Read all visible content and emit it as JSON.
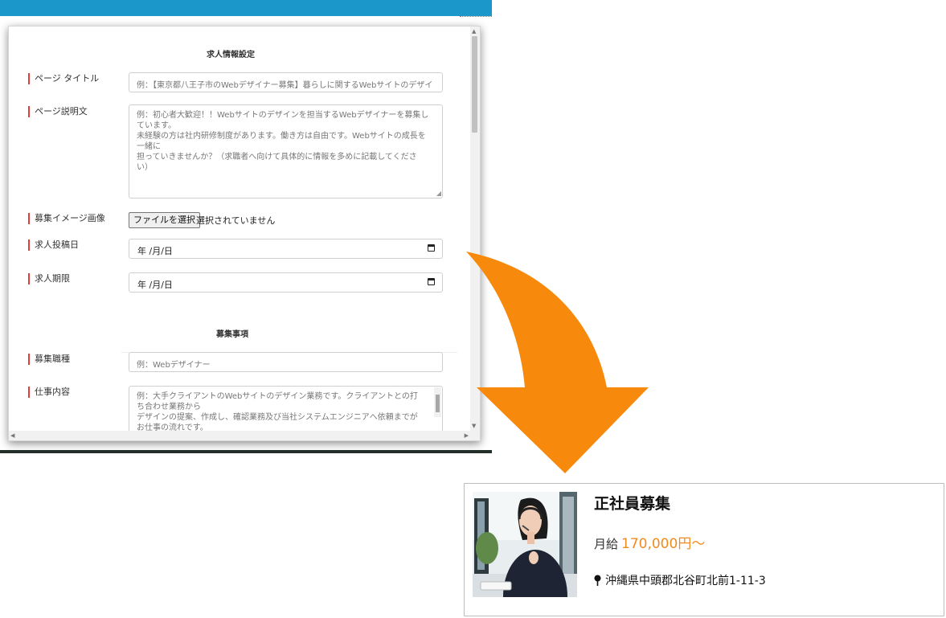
{
  "modal": {
    "section1_title": "求人情報設定",
    "section2_title": "募集事項",
    "page_title": {
      "label": "ページ タイトル",
      "placeholder": "例：【東京都八王子市のWebデザイナー募集】暮らしに関するWebサイトのデザイ"
    },
    "page_description": {
      "label": "ページ説明文",
      "placeholder_lines": [
        "例：初心者大歓迎！！Webサイトのデザインを担当するWebデザイナーを募集し",
        "ています。",
        "未経験の方は社内研修制度があります。働き方は自由です。Webサイトの成長を",
        "一緒に",
        "担っていきませんか？（求職者へ向けて具体的に情報を多めに記載してくださ",
        "い）"
      ]
    },
    "image": {
      "label": "募集イメージ画像",
      "button": "ファイルを選択",
      "status": "選択されていません"
    },
    "post_date": {
      "label": "求人投稿日",
      "value": "年 /月/日"
    },
    "deadline": {
      "label": "求人期限",
      "value": "年 /月/日"
    },
    "job_type": {
      "label": "募集職種",
      "placeholder": "例：Webデザイナー"
    },
    "job_content": {
      "label": "仕事内容",
      "placeholder_lines": [
        "例：大手クライアントのWebサイトのデザイン業務です。クライアントとの打",
        "ち合わせ業務から",
        "デザインの提案、作成し、確認業務及び当社システムエンジニアへ依頼までが",
        "お仕事の流れです。"
      ]
    }
  },
  "card": {
    "title": "正社員募集",
    "salary_label": "月給",
    "salary_value": "170,000円～",
    "address": "沖縄県中頭郡北谷町北前1-11-3",
    "image": "call-center-operator-photo"
  },
  "colors": {
    "accent_bar": "#1b98c9",
    "label_marker": "#e53b3b",
    "arrow": "#f7890c",
    "salary": "#f28a1e"
  }
}
